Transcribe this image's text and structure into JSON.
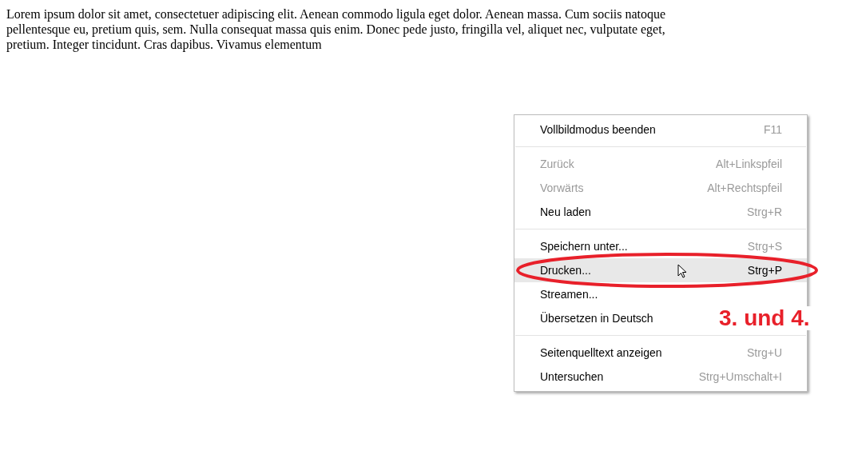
{
  "paragraph_lines": [
    "Lorem ipsum dolor sit amet, consectetuer adipiscing elit. Aenean commodo ligula eget dolor. Aenean massa. Cum sociis natoque",
    "pellentesque eu, pretium quis, sem. Nulla consequat massa quis enim. Donec pede justo, fringilla vel, aliquet nec, vulputate eget,",
    "pretium. Integer tincidunt. Cras dapibus. Vivamus elementum"
  ],
  "context_menu": {
    "groups": [
      [
        {
          "label": "Vollbildmodus beenden",
          "shortcut": "F11",
          "disabled": false,
          "selected": false
        }
      ],
      [
        {
          "label": "Zurück",
          "shortcut": "Alt+Linkspfeil",
          "disabled": true,
          "selected": false
        },
        {
          "label": "Vorwärts",
          "shortcut": "Alt+Rechtspfeil",
          "disabled": true,
          "selected": false
        },
        {
          "label": "Neu laden",
          "shortcut": "Strg+R",
          "disabled": false,
          "selected": false
        }
      ],
      [
        {
          "label": "Speichern unter...",
          "shortcut": "Strg+S",
          "disabled": false,
          "selected": false
        },
        {
          "label": "Drucken...",
          "shortcut": "Strg+P",
          "disabled": false,
          "selected": true
        },
        {
          "label": "Streamen...",
          "disabled": false,
          "selected": false
        },
        {
          "label": "Übersetzen in Deutsch",
          "disabled": false,
          "selected": false
        }
      ],
      [
        {
          "label": "Seitenquelltext anzeigen",
          "shortcut": "Strg+U",
          "disabled": false,
          "selected": false
        },
        {
          "label": "Untersuchen",
          "shortcut": "Strg+Umschalt+I",
          "disabled": false,
          "selected": false
        }
      ]
    ]
  },
  "annotation": {
    "text": "3. und 4."
  }
}
